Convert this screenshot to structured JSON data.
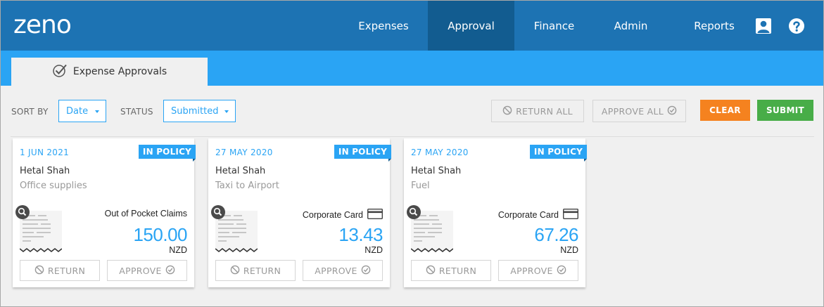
{
  "brand": {
    "logo_text": "zeno"
  },
  "nav": {
    "items": [
      {
        "label": "Expenses",
        "active": false
      },
      {
        "label": "Approval",
        "active": true
      },
      {
        "label": "Finance",
        "active": false
      },
      {
        "label": "Admin",
        "active": false
      },
      {
        "label": "Reports",
        "active": false
      }
    ],
    "icons": [
      "user-icon",
      "help-icon"
    ]
  },
  "subtab": {
    "label": "Expense Approvals",
    "icon": "check-circle-icon"
  },
  "toolbar": {
    "sort_by_label": "SORT BY",
    "sort_value": "Date",
    "status_label": "STATUS",
    "status_value": "Submitted",
    "return_all_label": "RETURN ALL",
    "approve_all_label": "APPROVE ALL",
    "clear_label": "CLEAR",
    "submit_label": "SUBMIT"
  },
  "cards": [
    {
      "date": "1 JUN 2021",
      "badge": "IN POLICY",
      "name": "Hetal Shah",
      "description": "Office supplies",
      "payment_type": "Out of Pocket Claims",
      "amount": "150.00",
      "currency": "NZD",
      "return_label": "RETURN",
      "approve_label": "APPROVE"
    },
    {
      "date": "27 MAY 2020",
      "badge": "IN POLICY",
      "name": "Hetal Shah",
      "description": "Taxi to Airport",
      "payment_type": "Corporate Card",
      "amount": "13.43",
      "currency": "NZD",
      "return_label": "RETURN",
      "approve_label": "APPROVE"
    },
    {
      "date": "27 MAY 2020",
      "badge": "IN POLICY",
      "name": "Hetal Shah",
      "description": "Fuel",
      "payment_type": "Corporate Card",
      "amount": "67.26",
      "currency": "NZD",
      "return_label": "RETURN",
      "approve_label": "APPROVE"
    }
  ],
  "colors": {
    "nav_bg": "#1d73b3",
    "nav_active": "#125c90",
    "accent": "#2aa4f4",
    "clear": "#f5821f",
    "submit": "#48ad48"
  }
}
